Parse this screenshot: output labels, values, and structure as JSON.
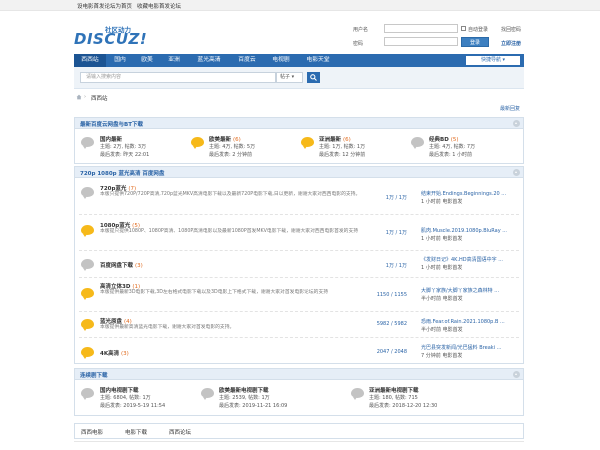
{
  "topbar": {
    "set_home": "设电影首发论坛为首页",
    "bookmark": "收藏电影首发论坛"
  },
  "logo": {
    "sub": "社区动力",
    "main": "DISCUZ!"
  },
  "login": {
    "username_label": "用户名",
    "password_label": "密码",
    "auto_login": "自动登录",
    "forgot": "找回密码",
    "login_button": "登录",
    "register": "立即注册"
  },
  "nav": {
    "items": [
      "西西站",
      "国内",
      "欧美",
      "亚洲",
      "蓝光高清",
      "百度云",
      "电视剧",
      "电影天堂"
    ],
    "quick": "快捷导航"
  },
  "search": {
    "placeholder": "请输入搜索内容",
    "type": "帖子"
  },
  "breadcrumb": {
    "current": "西西站",
    "sep": "›"
  },
  "latest_link": "最新回复",
  "section1": {
    "title": "最新百度云网盘与BT下载",
    "forums": [
      {
        "name": "国内最新",
        "count": "",
        "topics": "主题: 2万, 帖数: 3万",
        "last": "最后发表: 昨天 22:01",
        "icon": "gray"
      },
      {
        "name": "欧美最新",
        "count": "(6)",
        "topics": "主题: 4万, 帖数: 5万",
        "last": "最后发表: 2 分钟前",
        "icon": "yellow"
      },
      {
        "name": "亚洲最新",
        "count": "(6)",
        "topics": "主题: 1万, 帖数: 1万",
        "last": "最后发表: 12 分钟前",
        "icon": "yellow"
      },
      {
        "name": "经典BD",
        "count": "(5)",
        "topics": "主题: 4万, 帖数: 7万",
        "last": "最后发表: 1 小时前",
        "icon": "gray"
      }
    ]
  },
  "section2": {
    "title": "720p 1080p 蓝光高清 百度网盘",
    "forums": [
      {
        "name": "720p蓝光",
        "count": "(7)",
        "desc": "本版只提供720P/720P高清,720p蓝光MKV高清电影下载以及最新720P电影下载,日以更新，谢谢大家对西西电影的支持。",
        "stats": "1万 / 1万",
        "last_title": "结束开始.Endings.Beginnings.20 ...",
        "last_meta": "1 小时前  电影首发",
        "icon": "gray"
      },
      {
        "name": "1080p蓝光",
        "count": "(5)",
        "desc": "本版提只提供1080P、1080P高清、1080P高清电影以及最新1080P首发MKV电影下载，谢谢大家对西西电影首发的支持",
        "stats": "1万 / 1万",
        "last_title": "肌肉.Muscle.2019.1080p.BluRay ...",
        "last_meta": "1 小时前  电影首发",
        "icon": "yellow"
      },
      {
        "name": "百度网盘下载",
        "count": "(3)",
        "desc": "",
        "stats": "1万 / 1万",
        "last_title": "《发财日记》4K.HD高清国语中字 ...",
        "last_meta": "1 小时前  电影首发",
        "icon": "gray"
      },
      {
        "name": "高清立体3D",
        "count": "(1)",
        "desc": "本版提供最新3D电影下载,3D左右格式电影下载以及3D电影上下格式下载，谢谢大家对首发电影论坛的支持",
        "stats": "1150 / 1155",
        "last_title": "大脚丫家族/大脚丫家族之森林特 ...",
        "last_meta": "半小时前  电影首发",
        "icon": "yellow"
      },
      {
        "name": "蓝光原盘",
        "count": "(4)",
        "desc": "本版提供最新高清蓝光电影下载，谢谢大家对首发电影的支持。",
        "stats": "5982 / 5982",
        "last_title": "恐雨.Fear.of.Rain.2021.1080p.B ...",
        "last_meta": "半小时前  电影首发",
        "icon": "yellow"
      },
      {
        "name": "4K高清",
        "count": "(3)",
        "desc": "",
        "stats": "2047 / 2048",
        "last_title": "光巴县突发新闻/光巴猛料 Breaki ...",
        "last_meta": "7 分钟前  电影首发",
        "icon": "yellow"
      }
    ]
  },
  "section3": {
    "title": "连续剧下载",
    "forums": [
      {
        "name": "国内电视剧下载",
        "topics": "主题: 6804, 帖数: 1万",
        "last": "最后发表: 2019-5-19 11:54",
        "icon": "gray"
      },
      {
        "name": "欧美最新电视剧下载",
        "topics": "主题: 2539, 帖数: 1万",
        "last": "最后发表: 2019-11-21 16:09",
        "icon": "gray"
      },
      {
        "name": "亚洲最新电视剧下载",
        "topics": "主题: 180, 帖数: 715",
        "last": "最后发表: 2018-12-20 12:30",
        "icon": "gray"
      }
    ]
  },
  "friend_links": [
    "西西电影",
    "电影下载",
    "西西论坛"
  ]
}
